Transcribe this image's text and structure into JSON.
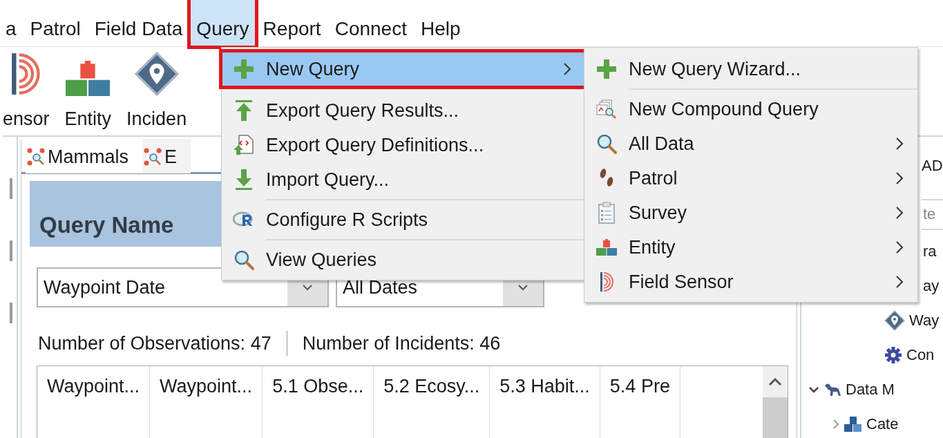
{
  "menu_bar": [
    {
      "label": "a",
      "highlighted": false
    },
    {
      "label": "Patrol",
      "highlighted": false
    },
    {
      "label": "Field Data",
      "highlighted": false
    },
    {
      "label": "Query",
      "highlighted": true
    },
    {
      "label": "Report",
      "highlighted": false
    },
    {
      "label": "Connect",
      "highlighted": false
    },
    {
      "label": "Help",
      "highlighted": false
    }
  ],
  "toolbar": [
    {
      "label": "ensor",
      "kind": "sensor"
    },
    {
      "label": "Entity",
      "kind": "blocks"
    },
    {
      "label": "Inciden",
      "kind": "waypoint"
    }
  ],
  "query_tabs": [
    {
      "label": "Mammals",
      "selected": true
    },
    {
      "label": "E",
      "selected": false
    }
  ],
  "query_panel": {
    "title": "Query Name",
    "group_by": {
      "value": "Waypoint Date"
    },
    "date_range": {
      "value": "All Dates"
    },
    "stats": [
      {
        "label": "Number of Observations: 47"
      },
      {
        "label": "Number of Incidents:  46"
      }
    ],
    "table": {
      "columns": [
        "Waypoint...",
        "Waypoint...",
        "5.1 Obse...",
        "5.2 Ecosy...",
        "5.3 Habit...",
        "5.4 Pre"
      ]
    }
  },
  "right_panel": {
    "heading": "AD",
    "filter": {
      "placeholder": "te"
    },
    "tree": [
      {
        "label": "ra"
      },
      {
        "label": "ay"
      },
      {
        "label": "Way",
        "kind": "waypoint"
      },
      {
        "label": "Con",
        "kind": "gear"
      },
      {
        "label": "Data M",
        "kind": "animal",
        "expanded": true,
        "children": [
          {
            "label": "Cate",
            "kind": "blocks-blue",
            "expanded": false
          }
        ]
      }
    ]
  },
  "query_menu": [
    {
      "kind": "plus",
      "label": "New Query",
      "submenu": true,
      "highlighted": true
    },
    {
      "kind": "export-up",
      "label": "Export Query Results...",
      "submenu": false,
      "highlighted": false
    },
    {
      "kind": "export-def",
      "label": "Export Query Definitions...",
      "submenu": false,
      "highlighted": false
    },
    {
      "kind": "import-down",
      "label": "Import Query...",
      "submenu": false,
      "highlighted": false
    },
    {
      "kind": "separator"
    },
    {
      "kind": "r-logo",
      "label": "Configure R Scripts",
      "submenu": false,
      "highlighted": false
    },
    {
      "kind": "separator"
    },
    {
      "kind": "magnifier",
      "label": "View Queries",
      "submenu": false,
      "highlighted": false
    }
  ],
  "new_query_submenu": [
    {
      "kind": "plus",
      "label": "New Query Wizard...",
      "submenu": false,
      "highlighted": false
    },
    {
      "kind": "separator"
    },
    {
      "kind": "compound",
      "label": "New Compound Query",
      "submenu": false,
      "highlighted": false
    },
    {
      "kind": "magnifier",
      "label": "All Data",
      "submenu": true,
      "highlighted": false
    },
    {
      "kind": "footprints",
      "label": "Patrol",
      "submenu": true,
      "highlighted": false
    },
    {
      "kind": "clipboard",
      "label": "Survey",
      "submenu": true,
      "highlighted": false
    },
    {
      "kind": "blocks",
      "label": "Entity",
      "submenu": true,
      "highlighted": false
    },
    {
      "kind": "sensor",
      "label": "Field Sensor",
      "submenu": true,
      "highlighted": false
    }
  ]
}
